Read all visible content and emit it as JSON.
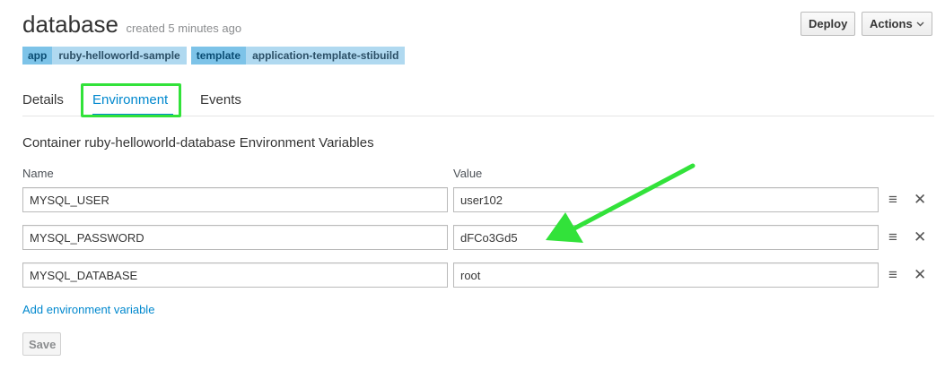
{
  "header": {
    "title": "database",
    "created": "created 5 minutes ago",
    "labels": [
      {
        "key": "app",
        "value": "ruby-helloworld-sample"
      },
      {
        "key": "template",
        "value": "application-template-stibuild"
      }
    ],
    "deploy_label": "Deploy",
    "actions_label": "Actions"
  },
  "tabs": [
    {
      "label": "Details",
      "active": false
    },
    {
      "label": "Environment",
      "active": true
    },
    {
      "label": "Events",
      "active": false
    }
  ],
  "section": {
    "title": "Container ruby-helloworld-database Environment Variables",
    "name_header": "Name",
    "value_header": "Value"
  },
  "env": [
    {
      "name": "MYSQL_USER",
      "value": "user102"
    },
    {
      "name": "MYSQL_PASSWORD",
      "value": "dFCo3Gd5"
    },
    {
      "name": "MYSQL_DATABASE",
      "value": "root"
    }
  ],
  "add_link": "Add environment variable",
  "save_label": "Save",
  "colors": {
    "accent": "#0088ce",
    "highlight": "#32e23a",
    "label_key_bg": "#7dc3e8",
    "label_value_bg": "#b0d9f0"
  },
  "icons": {
    "drag": "drag-handle-icon",
    "remove": "close-icon",
    "caret": "chevron-down-icon",
    "annotation": "arrow-annotation-icon"
  }
}
